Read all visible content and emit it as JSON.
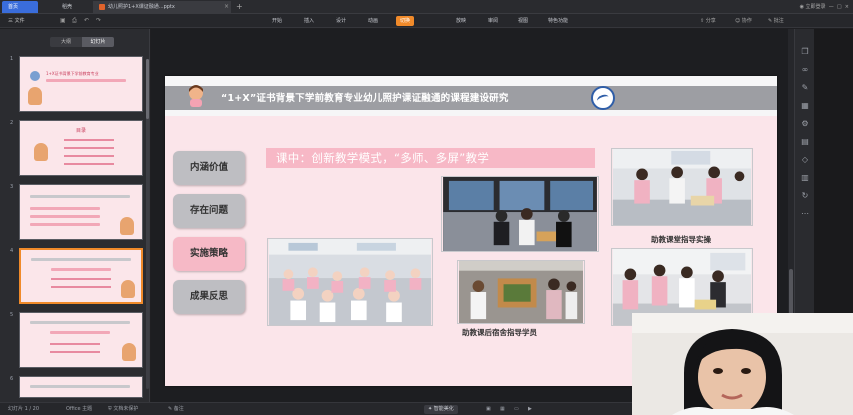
{
  "titlebar": {
    "tabs": [
      {
        "label": "首页"
      },
      {
        "label": "稻壳"
      },
      {
        "label": "幼儿照护1+X课证融通...pptx"
      }
    ],
    "right_label": "立即登录"
  },
  "menubar": {
    "file": "三 文件",
    "items": [
      "开始",
      "插入",
      "设计",
      "动画",
      "切换",
      "放映",
      "审阅",
      "视图",
      "特色功能"
    ],
    "highlight_index": 4,
    "right": [
      "分享",
      "协作",
      "批注"
    ]
  },
  "left_panel": {
    "tabs": [
      "大纲",
      "幻灯片"
    ],
    "active_tab": 1,
    "thumbs": [
      {
        "num": "1",
        "label": "1+X证书背景下学前教育专业"
      },
      {
        "num": "2",
        "label": "目录"
      },
      {
        "num": "3",
        "label": ""
      },
      {
        "num": "4",
        "label": ""
      },
      {
        "num": "5",
        "label": ""
      },
      {
        "num": "6",
        "label": ""
      }
    ],
    "selected_index": 3
  },
  "slide": {
    "title": "“1+X”证书背景下学前教育专业幼儿照护课证融通的课程建设研究",
    "subtitle": "课中：创新教学模式，“多师、多屏”教学",
    "nav": [
      "内涵价值",
      "存在问题",
      "实施策略",
      "成果反思"
    ],
    "active_nav": 2,
    "captions": {
      "classroom": "助教课堂指导实操",
      "dorm": "助教课后宿舍指导学员"
    }
  },
  "statusbar": {
    "page": "幻灯片 1 / 20",
    "theme": "Office 主题",
    "backup": "文档未保护",
    "note": "备注",
    "zoom_label": "智能美化"
  },
  "colors": {
    "accent_orange": "#f08a2a",
    "slide_bg": "#fbe5ea",
    "nav_active": "#f6b9c6",
    "header_bar": "#9d9ea3"
  }
}
